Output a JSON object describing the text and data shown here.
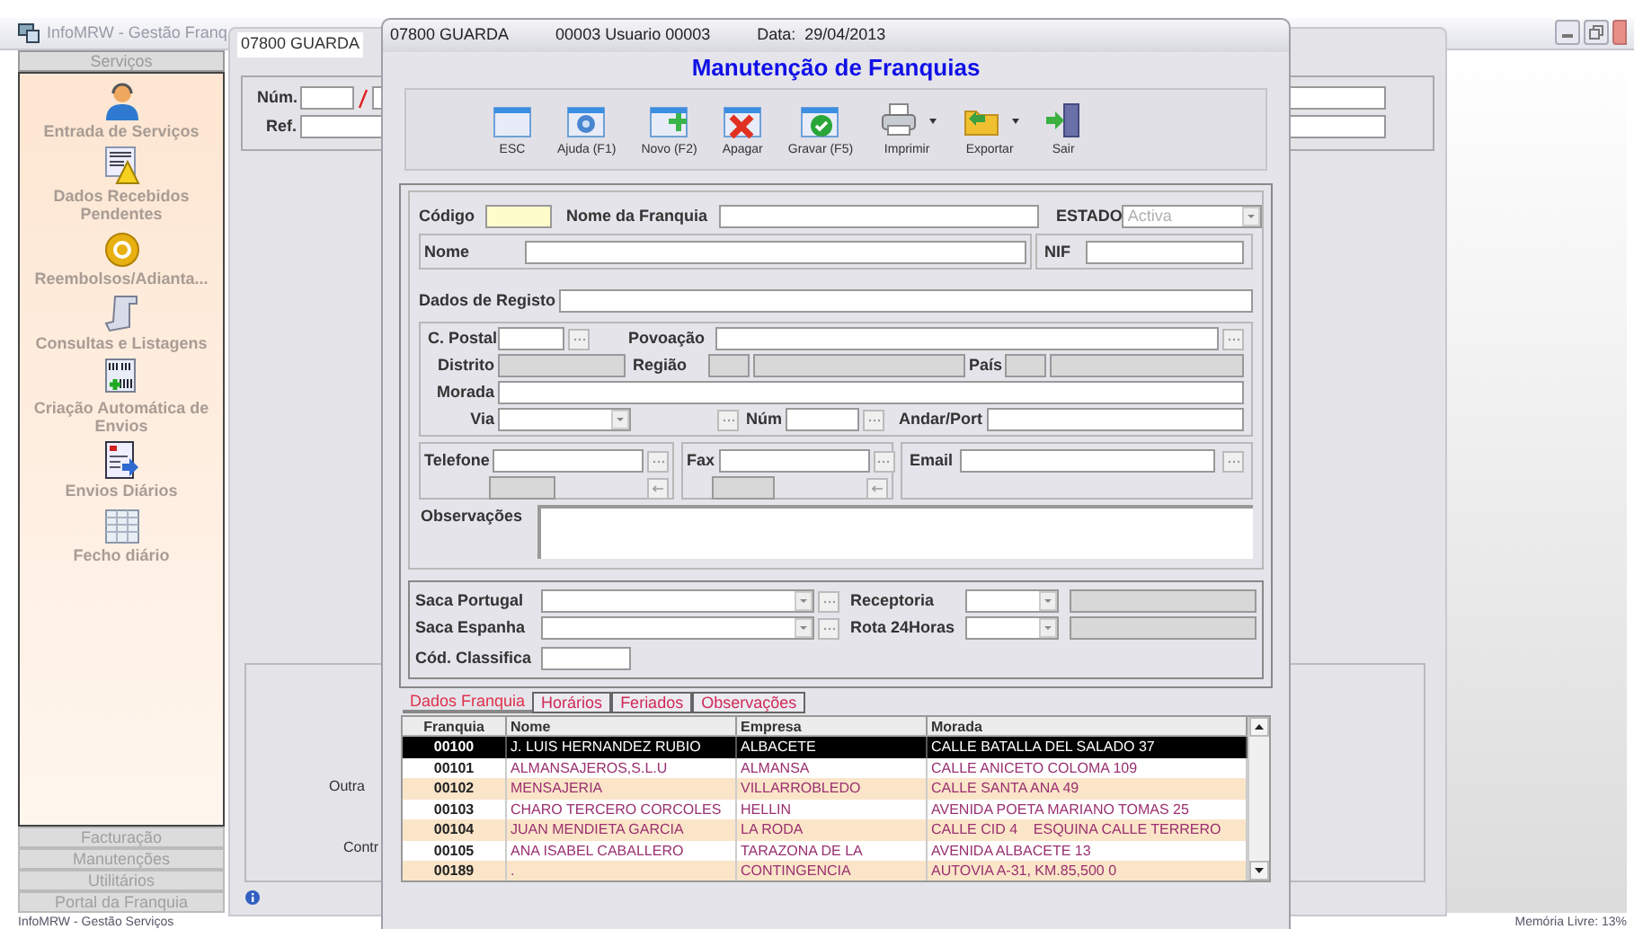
{
  "app": {
    "title": "InfoMRW - Gestão Franq",
    "status_left": "InfoMRW - Gestão Serviços",
    "status_right": "Memória Livre: 13%"
  },
  "sidebar": {
    "header": "Serviços",
    "items": [
      {
        "label": "Entrada de Serviços",
        "kind": "headset"
      },
      {
        "label": "Dados Recebidos Pendentes",
        "kind": "warning"
      },
      {
        "label": "Reembolsos/Adianta...",
        "kind": "coin"
      },
      {
        "label": "Consultas e Listagens",
        "kind": "scroll"
      },
      {
        "label": "Criação Automática de Envios",
        "kind": "barcode"
      },
      {
        "label": "Envios Diários",
        "kind": "send"
      },
      {
        "label": "Fecho diário",
        "kind": "sheet"
      }
    ],
    "sections": [
      "Facturação",
      "Manutenções",
      "Utilitários",
      "Portal da Franquia"
    ]
  },
  "main_window": {
    "tab": "07800 GUARDA",
    "num_label": "Núm.",
    "ref_label": "Ref.",
    "lower_labels": [
      "Outra",
      "Contr"
    ]
  },
  "dialog": {
    "header": [
      "07800 GUARDA",
      "00003 Usuario 00003",
      "Data:  29/04/2013"
    ],
    "title": "Manutenção de Franquias",
    "toolbar": [
      {
        "label": "ESC",
        "kind": "window",
        "dropdown": false
      },
      {
        "label": "Ajuda (F1)",
        "kind": "help",
        "dropdown": false
      },
      {
        "label": "Novo (F2)",
        "kind": "add",
        "dropdown": false
      },
      {
        "label": "Apagar",
        "kind": "delete",
        "dropdown": false
      },
      {
        "label": "Gravar (F5)",
        "kind": "save",
        "dropdown": false
      },
      {
        "label": "Imprimir",
        "kind": "print",
        "dropdown": true
      },
      {
        "label": "Exportar",
        "kind": "export",
        "dropdown": true
      },
      {
        "label": "Sair",
        "kind": "exit",
        "dropdown": false
      }
    ],
    "form": {
      "codigo": {
        "label": "Código"
      },
      "nome_franquia": {
        "label": "Nome da Franquia"
      },
      "estado": {
        "label": "ESTADO",
        "value": "Activa",
        "disabled": true
      },
      "nome": {
        "label": "Nome"
      },
      "nif": {
        "label": "NIF"
      },
      "dados_registo": {
        "label": "Dados de Registo"
      },
      "codigo_postal": {
        "label": "C. Postal"
      },
      "povoacao": {
        "label": "Povoação"
      },
      "distrito": {
        "label": "Distrito",
        "disabled": true
      },
      "regiao": {
        "label": "Região",
        "disabled": true
      },
      "pais": {
        "label": "País",
        "disabled": true
      },
      "morada": {
        "label": "Morada"
      },
      "via": {
        "label": "Via"
      },
      "num": {
        "label": "Núm"
      },
      "andar": {
        "label": "Andar/Port"
      },
      "telefone": {
        "label": "Telefone"
      },
      "fax": {
        "label": "Fax"
      },
      "email": {
        "label": "Email"
      },
      "observacoes": {
        "label": "Observações"
      },
      "saca_portugal": {
        "label": "Saca Portugal"
      },
      "saca_espanha": {
        "label": "Saca Espanha"
      },
      "receptoria": {
        "label": "Receptoria"
      },
      "rota": {
        "label": "Rota 24Horas"
      },
      "cod_classifica": {
        "label": "Cód. Classifica"
      }
    },
    "tabs": [
      {
        "label": "Dados Franquia",
        "selected": true
      },
      {
        "label": "Horários",
        "selected": false
      },
      {
        "label": "Feriados",
        "selected": false
      },
      {
        "label": "Observações",
        "selected": false
      }
    ],
    "table": {
      "columns": [
        "Franquia",
        "Nome",
        "Empresa",
        "Morada"
      ],
      "rows": [
        {
          "cells": [
            "00100",
            "J. LUIS HERNANDEZ RUBIO",
            "ALBACETE",
            "CALLE BATALLA DEL SALADO 37"
          ],
          "selected": true
        },
        {
          "cells": [
            "00101",
            "ALMANSAJEROS,S.L.U",
            "ALMANSA",
            "CALLE ANICETO COLOMA 109"
          ],
          "selected": false
        },
        {
          "cells": [
            "00102",
            "MENSAJERIA",
            "VILLARROBLEDO",
            "CALLE SANTA ANA 49"
          ],
          "selected": false
        },
        {
          "cells": [
            "00103",
            "CHARO TERCERO CORCOLES",
            "HELLIN",
            "AVENIDA POETA MARIANO TOMAS 25"
          ],
          "selected": false
        },
        {
          "cells": [
            "00104",
            "JUAN MENDIETA GARCIA",
            "LA RODA",
            "CALLE CID 4    ESQUINA CALLE TERRERO"
          ],
          "selected": false
        },
        {
          "cells": [
            "00105",
            "ANA ISABEL CABALLERO",
            "TARAZONA DE LA",
            "AVENIDA ALBACETE 13"
          ],
          "selected": false
        },
        {
          "cells": [
            "00189",
            ".",
            "CONTINGENCIA",
            "AUTOVIA A-31, KM.85,500 0"
          ],
          "selected": false
        }
      ]
    }
  }
}
